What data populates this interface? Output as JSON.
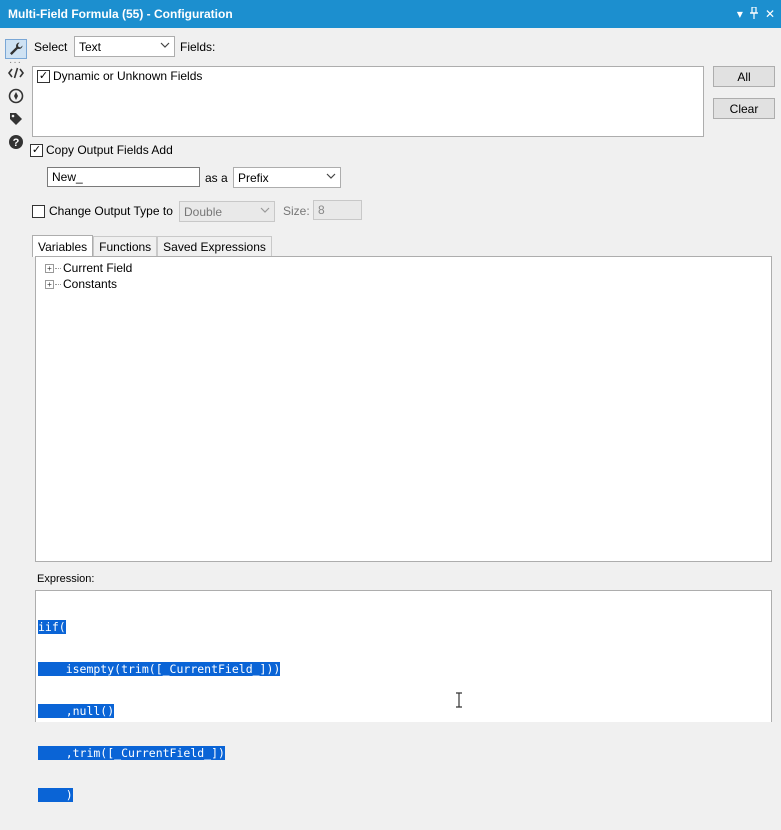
{
  "window": {
    "title": "Multi-Field Formula (55) - Configuration",
    "controls": {
      "dropdown": "▾",
      "pin": "📌",
      "close": "✕"
    }
  },
  "sidebar": {
    "dots": "···",
    "tools": [
      {
        "name": "configuration",
        "icon": "wrench-icon"
      },
      {
        "name": "xml",
        "icon": "code-icon"
      },
      {
        "name": "annotation",
        "icon": "compass-icon"
      },
      {
        "name": "tag",
        "icon": "tag-icon"
      },
      {
        "name": "help",
        "icon": "help-icon"
      }
    ]
  },
  "select_row": {
    "label": "Select",
    "value": "Text",
    "fields_label": "Fields:"
  },
  "fields": {
    "items": [
      {
        "label": "Dynamic or Unknown Fields",
        "checked": true
      }
    ],
    "all_label": "All",
    "clear_label": "Clear"
  },
  "copy_output": {
    "label": "Copy Output Fields Add",
    "checked": true,
    "value": "New_",
    "as_a_label": "as a",
    "position_value": "Prefix"
  },
  "change_type": {
    "label": "Change Output Type to",
    "checked": false,
    "type_value": "Double",
    "size_label": "Size:",
    "size_value": "8"
  },
  "tabs": [
    {
      "label": "Variables",
      "active": true
    },
    {
      "label": "Functions",
      "active": false
    },
    {
      "label": "Saved Expressions",
      "active": false
    }
  ],
  "variables": {
    "items": [
      {
        "label": "Current Field"
      },
      {
        "label": "Constants"
      }
    ]
  },
  "expression": {
    "label": "Expression:",
    "lines": [
      "iif(",
      "    isempty(trim([_CurrentField_]))",
      "    ,null()",
      "    ,trim([_CurrentField_])",
      "    )"
    ]
  },
  "colors": {
    "titlebar": "#1c8fcf",
    "selection": "#0a64d6"
  }
}
